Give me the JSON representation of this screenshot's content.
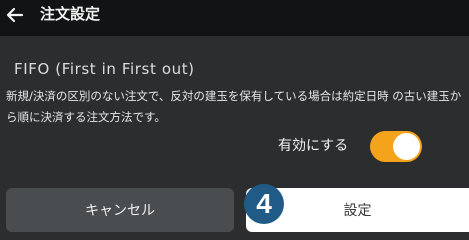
{
  "header": {
    "back_icon": "arrow-left-icon",
    "title": "注文設定"
  },
  "option": {
    "title": "FIFO (First in First out)",
    "description": "新規/決済の区別のない注文で、反対の建玉を保有している場合は約定日時 の古い建玉から順に決済する注文方法です。"
  },
  "toggle": {
    "label": "有効にする",
    "enabled": true,
    "color": "#f5a31a"
  },
  "buttons": {
    "cancel_label": "キャンセル",
    "set_label": "設定"
  },
  "badge": {
    "text": "4",
    "color": "#1f5b86"
  }
}
